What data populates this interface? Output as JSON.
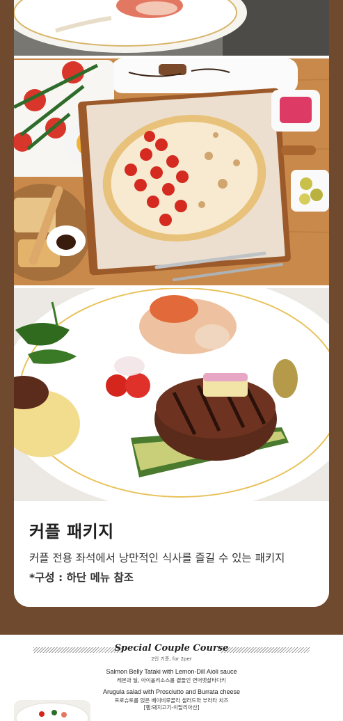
{
  "package": {
    "title": "커플 패키지",
    "description": "커플 전용 좌석에서 낭만적인 식사를 즐길 수 있는 패키지",
    "note": "*구성 : 하단 메뉴 참조"
  },
  "menu": {
    "course_title": "Special Couple Course",
    "course_subtitle": "2인 기준, for 2per",
    "items": [
      {
        "en": "Salmon Belly Tataki with Lemon-Dill Aioli sauce",
        "ko": "레몬과 딜, 아이올리소스를 곁들인 연어뱃살타다키"
      },
      {
        "en": "Arugula salad with Prosciutto and Burrata cheese",
        "ko": "프로슈토를 얹은 베이비루꼴라 샐러드와 부라타 치즈",
        "ko2": "[햄:돼지고기-이탈리아산]"
      }
    ]
  },
  "colors": {
    "brown_background": "#6f4a2f",
    "card": "#ffffff",
    "title_text": "#1f1f1f"
  }
}
